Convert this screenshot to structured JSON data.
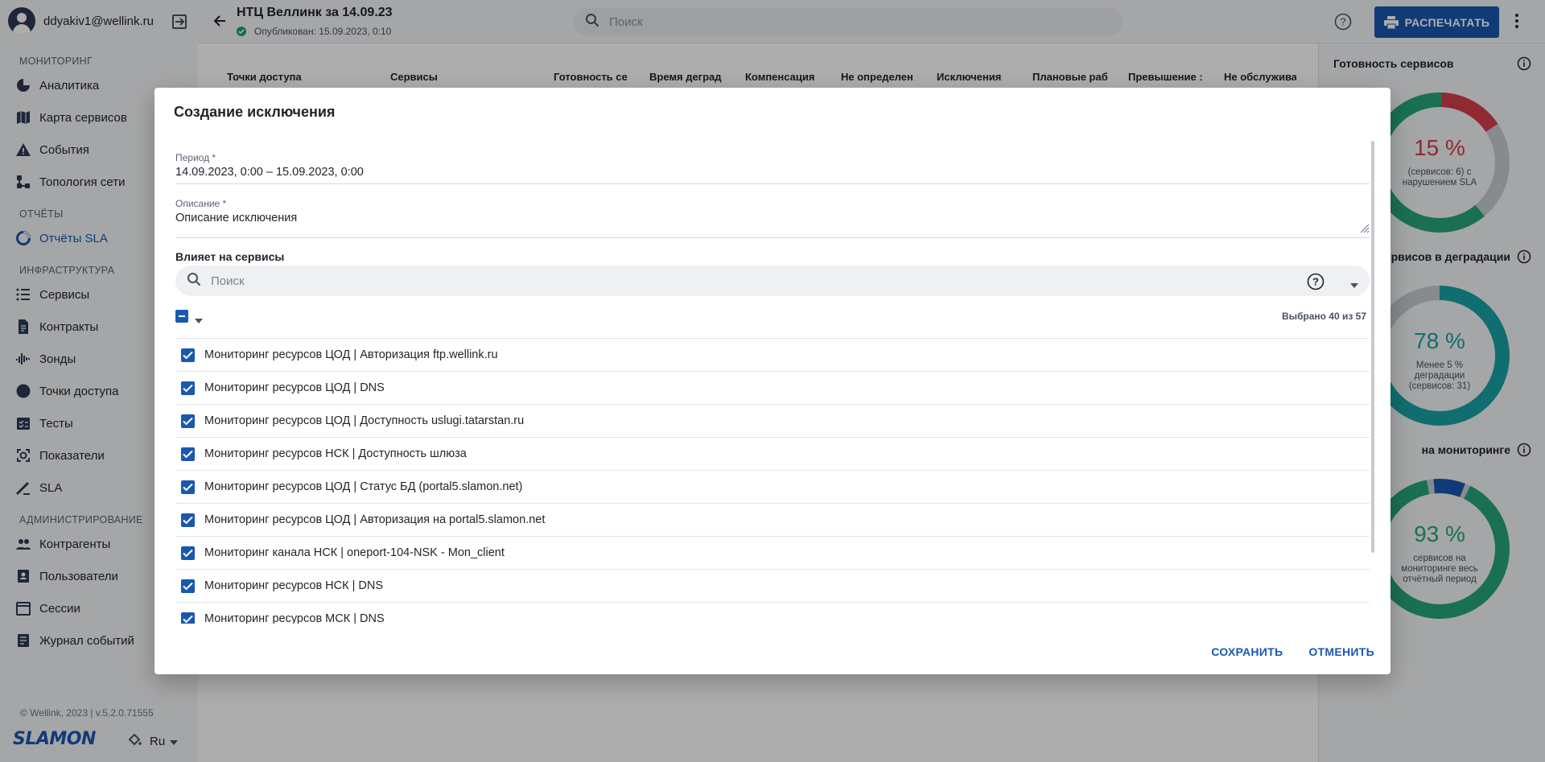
{
  "user": {
    "email": "ddyakiv1@wellink.ru"
  },
  "sidebar": {
    "sections": [
      {
        "title": "МОНИТОРИНГ",
        "items": [
          {
            "label": "Аналитика",
            "icon": "pie-chart-icon"
          },
          {
            "label": "Карта сервисов",
            "icon": "map-icon"
          },
          {
            "label": "События",
            "icon": "warning-icon"
          },
          {
            "label": "Топология сети",
            "icon": "topology-icon"
          }
        ]
      },
      {
        "title": "ОТЧЁТЫ",
        "items": [
          {
            "label": "Отчёты SLA",
            "icon": "report-icon",
            "active": true
          }
        ]
      },
      {
        "title": "ИНФРАСТРУКТУРА",
        "items": [
          {
            "label": "Сервисы",
            "icon": "list-icon"
          },
          {
            "label": "Контракты",
            "icon": "document-icon"
          },
          {
            "label": "Зонды",
            "icon": "probe-icon"
          },
          {
            "label": "Точки доступа",
            "icon": "access-point-icon"
          },
          {
            "label": "Тесты",
            "icon": "checklist-icon"
          },
          {
            "label": "Показатели",
            "icon": "metrics-icon"
          },
          {
            "label": "SLA",
            "icon": "sla-icon"
          }
        ]
      },
      {
        "title": "АДМИНИСТРИРОВАНИЕ",
        "items": [
          {
            "label": "Контрагенты",
            "icon": "people-icon"
          },
          {
            "label": "Пользователи",
            "icon": "user-card-icon"
          },
          {
            "label": "Сессии",
            "icon": "calendar-icon"
          },
          {
            "label": "Журнал событий",
            "icon": "journal-icon"
          }
        ]
      }
    ],
    "footer": "© Wellink, 2023 | v.5.2.0.71555",
    "logo": "SLAMON",
    "language": "Ru"
  },
  "header": {
    "title": "НТЦ Веллинк за 14.09.23",
    "published": "Опубликован: 15.09.2023, 0:10",
    "search_placeholder": "Поиск",
    "print_label": "РАСПЕЧАТАТЬ"
  },
  "table": {
    "columns": [
      "Точки доступа",
      "Сервисы",
      "Готовность се",
      "Время деград",
      "Компенсация",
      "Не определен",
      "Исключения",
      "Плановые раб",
      "Превышение :",
      "Не обслужива"
    ]
  },
  "right_panel": {
    "cards": [
      {
        "title": "Готовность сервисов",
        "percent": "15 %",
        "caption": [
          "(сервисов: 6) с",
          "нарушением SLA"
        ],
        "value": 15,
        "color": "#d63d4a"
      },
      {
        "title": "рвисов в деградации",
        "percent": "78 %",
        "caption": [
          "Менее 5 %",
          "деградации",
          "(сервисов: 31)"
        ],
        "value": 78,
        "color": "#1aa3a6"
      },
      {
        "title": "на мониторинге",
        "percent": "93 %",
        "caption": [
          "сервисов на",
          "мониторинге весь",
          "отчётный период"
        ],
        "value": 93,
        "color": "#27a57a"
      }
    ]
  },
  "dialog": {
    "title": "Создание исключения",
    "period_label": "Период *",
    "period_value": "14.09.2023, 0:00 – 15.09.2023, 0:00",
    "description_label": "Описание *",
    "description_value": "Описание исключения",
    "affects_label": "Влияет на сервисы",
    "search_placeholder": "Поиск",
    "selected_count": "Выбрано 40 из 57",
    "services": [
      "Мониторинг ресурсов ЦОД | Авторизация ftp.wellink.ru",
      "Мониторинг ресурсов ЦОД | DNS",
      "Мониторинг ресурсов ЦОД | Доступность uslugi.tatarstan.ru",
      "Мониторинг ресурсов НСК | Доступность шлюза",
      "Мониторинг ресурсов ЦОД | Статус БД (portal5.slamon.net)",
      "Мониторинг ресурсов ЦОД | Авторизация на portal5.slamon.net",
      "Мониторинг канала НСК | oneport-104-NSK - Mon_client",
      "Мониторинг ресурсов НСК | DNS",
      "Мониторинг ресурсов МСК | DNS"
    ],
    "save_label": "СОХРАНИТЬ",
    "cancel_label": "ОТМЕНИТЬ"
  },
  "colors": {
    "accent": "#1a58b0",
    "success": "#21a366"
  }
}
